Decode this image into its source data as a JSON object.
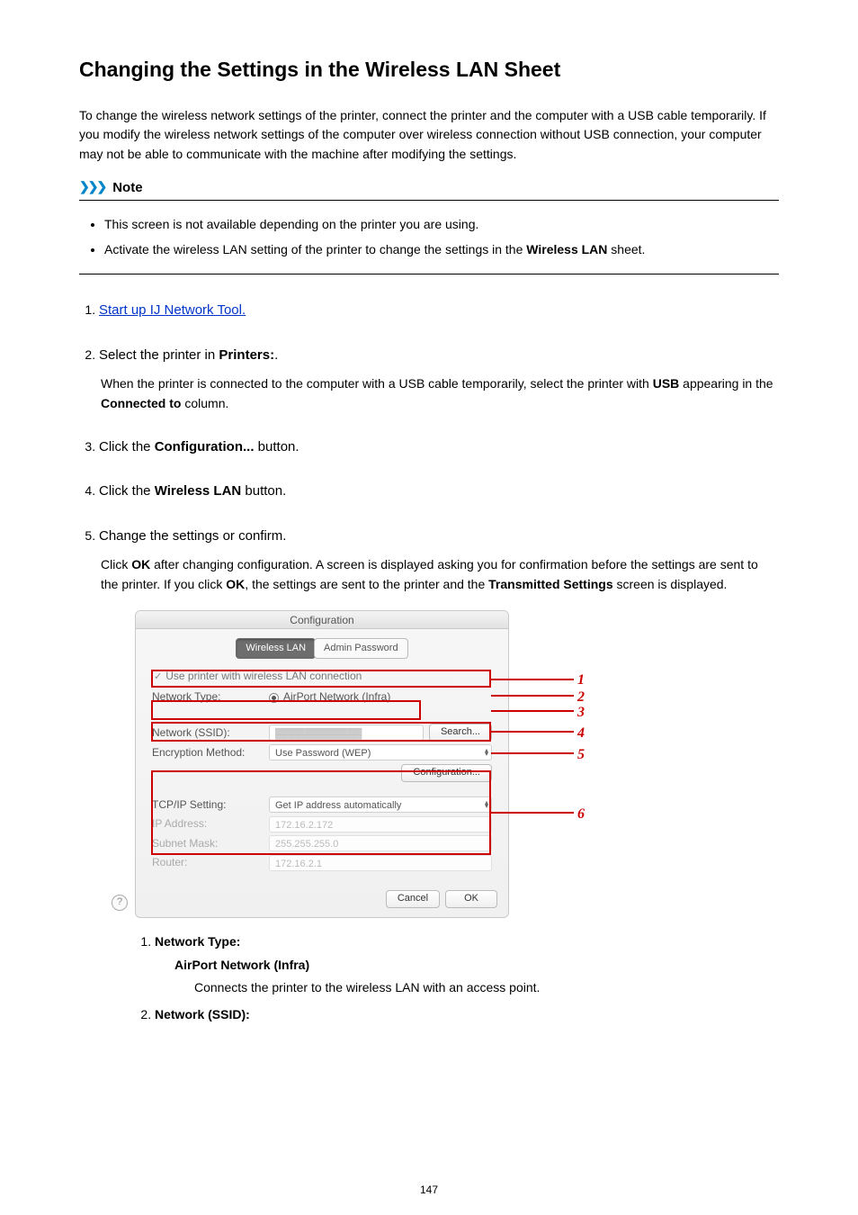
{
  "title": "Changing the Settings in the Wireless LAN Sheet",
  "intro": "To change the wireless network settings of the printer, connect the printer and the computer with a USB cable temporarily. If you modify the wireless network settings of the computer over wireless connection without USB connection, your computer may not be able to communicate with the machine after modifying the settings.",
  "note": {
    "label": "Note",
    "items": [
      "This screen is not available depending on the printer you are using.",
      {
        "pre": "Activate the wireless LAN setting of the printer to change the settings in the ",
        "bold": "Wireless LAN",
        "post": " sheet."
      }
    ]
  },
  "steps": {
    "s1": {
      "link": "Start up IJ Network Tool."
    },
    "s2": {
      "head_pre": "Select the printer in ",
      "head_bold": "Printers:",
      "head_post": ".",
      "body_pre": "When the printer is connected to the computer with a USB cable temporarily, select the printer with ",
      "body_bold1": "USB",
      "body_mid": " appearing in the ",
      "body_bold2": "Connected to",
      "body_post": " column."
    },
    "s3": {
      "pre": "Click the ",
      "bold": "Configuration...",
      "post": " button."
    },
    "s4": {
      "pre": "Click the ",
      "bold": "Wireless LAN",
      "post": " button."
    },
    "s5": {
      "head": "Change the settings or confirm.",
      "body_pre": "Click ",
      "b1": "OK",
      "body_mid1": " after changing configuration. A screen is displayed asking you for confirmation before the settings are sent to the printer. If you click ",
      "b2": "OK",
      "body_mid2": ", the settings are sent to the printer and the ",
      "b3": "Transmitted Settings",
      "body_post": " screen is displayed."
    }
  },
  "dialog": {
    "title": "Configuration",
    "tabs": {
      "t1": "Wireless LAN",
      "t2": "Admin Password"
    },
    "use_printer": "Use printer with wireless LAN connection",
    "network_type_lbl": "Network Type:",
    "network_type_val": "AirPort Network (Infra)",
    "ssid_lbl": "Network (SSID):",
    "ssid_val": "▓▓▓▓▓▓▓▓▓▓▓▓",
    "search_btn": "Search...",
    "enc_lbl": "Encryption Method:",
    "enc_val": "Use Password (WEP)",
    "config_btn": "Configuration...",
    "tcpip_lbl": "TCP/IP Setting:",
    "tcpip_val": "Get IP address automatically",
    "ip_lbl": "IP Address:",
    "ip_val": "172.16.2.172",
    "subnet_lbl": "Subnet Mask:",
    "subnet_val": "255.255.255.0",
    "router_lbl": "Router:",
    "router_val": "172.16.2.1",
    "help": "?",
    "cancel": "Cancel",
    "ok": "OK"
  },
  "callouts": {
    "n1": "1",
    "n2": "2",
    "n3": "3",
    "n4": "4",
    "n5": "5",
    "n6": "6"
  },
  "sublist": {
    "i1": {
      "head": "Network Type:",
      "label": "AirPort Network (Infra)",
      "desc": "Connects the printer to the wireless LAN with an access point."
    },
    "i2": {
      "head": "Network (SSID):"
    }
  },
  "page_number": "147"
}
